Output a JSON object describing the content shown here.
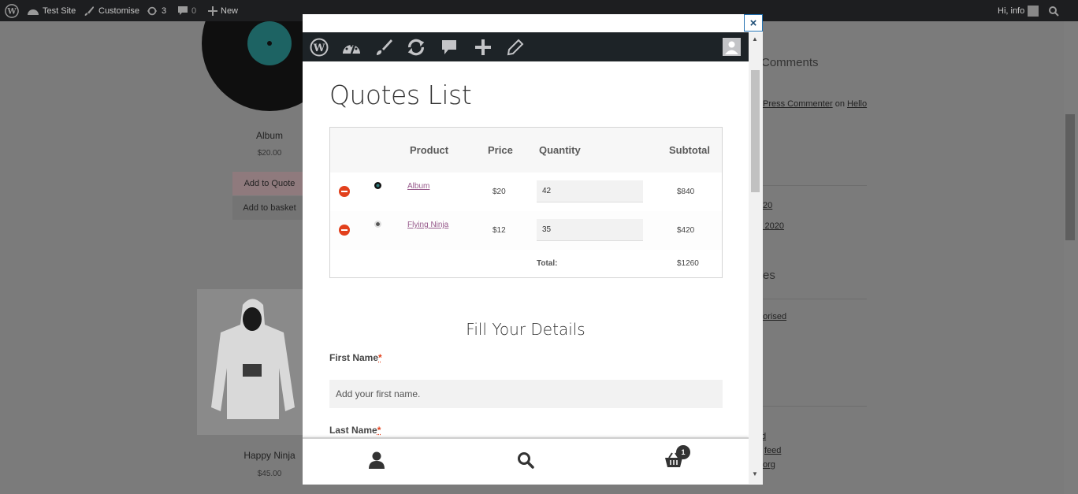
{
  "admin_bar": {
    "site_name": "Test Site",
    "customise": "Customise",
    "updates_count": "3",
    "comments_count": "0",
    "new_label": "New",
    "greeting": "Hi, info"
  },
  "background": {
    "products": [
      {
        "name": "Album",
        "price": "$20.00",
        "add_quote": "Add to Quote",
        "add_basket": "Add to basket"
      },
      {
        "name": "Happy Ninja",
        "price": "$45.00"
      }
    ],
    "sidebar": {
      "recent_comments_heading": "Comments",
      "comment_author": "Press Commenter",
      "comment_on": "on",
      "comment_post": "Hello",
      "archive_1": "20",
      "archive_2": "y 2020",
      "categories_heading": "es",
      "category_1": "gorised",
      "meta_1": "d",
      "meta_2": "feed",
      "meta_3": "org"
    }
  },
  "modal": {
    "close_label": "×",
    "title": "Quotes List",
    "table": {
      "headers": {
        "product": "Product",
        "price": "Price",
        "quantity": "Quantity",
        "subtotal": "Subtotal"
      },
      "rows": [
        {
          "product": "Album",
          "price": "$20",
          "quantity": "42",
          "subtotal": "$840"
        },
        {
          "product": "Flying Ninja",
          "price": "$12",
          "quantity": "35",
          "subtotal": "$420"
        }
      ],
      "total_label": "Total:",
      "total_value": "$1260"
    },
    "form": {
      "heading": "Fill Your Details",
      "first_name_label": "First Name",
      "first_name_placeholder": "Add your first name.",
      "last_name_label": "Last Name",
      "required_mark": "*"
    },
    "footer": {
      "cart_count": "1"
    }
  },
  "colors": {
    "accent_link": "#96588a",
    "remove_red": "#e2401c",
    "admin_bar": "#1d2327"
  }
}
